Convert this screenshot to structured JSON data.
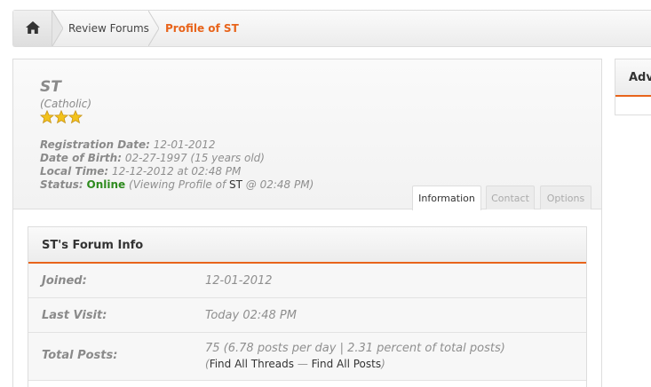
{
  "breadcrumb": {
    "home_icon": "home-icon",
    "items": [
      "Review Forums",
      "Profile of ST"
    ]
  },
  "profile": {
    "username": "ST",
    "usertitle": "(Catholic)",
    "stars": 3,
    "registration_label": "Registration Date:",
    "registration_value": "12-01-2012",
    "dob_label": "Date of Birth:",
    "dob_value": "02-27-1997 (15 years old)",
    "localtime_label": "Local Time:",
    "localtime_value": "12-12-2012 at 02:48 PM",
    "status_label": "Status:",
    "status_value": "Online",
    "status_activity_prefix": "(Viewing Profile of",
    "status_activity_user": "ST",
    "status_activity_suffix": "@ 02:48 PM)"
  },
  "tabs": [
    "Information",
    "Contact",
    "Options"
  ],
  "forum_info": {
    "title": "ST's Forum Info",
    "rows": [
      {
        "label": "Joined:",
        "value": "12-01-2012"
      },
      {
        "label": "Last Visit:",
        "value": "Today 02:48 PM"
      },
      {
        "label": "Total Posts:",
        "value": "75 (6.78 posts per day | 2.31 percent of total posts)"
      }
    ],
    "find_open": "(",
    "find_threads": "Find All Threads",
    "find_sep": "—",
    "find_posts": "Find All Posts",
    "find_close": ")"
  },
  "sidebar": {
    "title": "Adv"
  },
  "colors": {
    "accent": "#e8641b",
    "online": "#2e8b1e"
  }
}
